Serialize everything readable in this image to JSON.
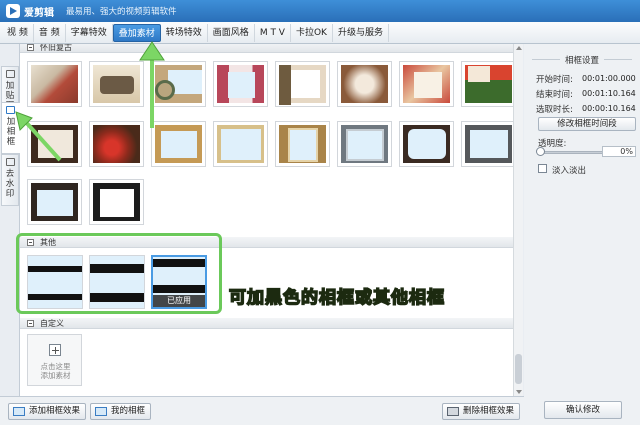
{
  "app": {
    "name": "爱剪辑",
    "slogan": "最易用、强大的视频剪辑软件"
  },
  "menu": {
    "items": [
      {
        "label": "视 频"
      },
      {
        "label": "音 频"
      },
      {
        "label": "字幕特效"
      },
      {
        "label": "叠加素材",
        "active": true
      },
      {
        "label": "转场特效"
      },
      {
        "label": "画面风格"
      },
      {
        "label": "M T V"
      },
      {
        "label": "卡拉OK"
      },
      {
        "label": "升级与服务"
      }
    ]
  },
  "sidetabs": [
    {
      "label": "加贴图"
    },
    {
      "label": "加相框",
      "active": true
    },
    {
      "label": "去水印"
    }
  ],
  "sections": {
    "retro": {
      "label": "怀旧复古"
    },
    "other": {
      "label": "其他"
    },
    "custom": {
      "label": "自定义"
    }
  },
  "applied_label": "已应用",
  "custom_add": {
    "line1": "点击这里",
    "line2": "添加素材"
  },
  "annotation": "可加黑色的相框或其他相框",
  "bottom": {
    "add_frame": "添加相框效果",
    "my_frames": "我的相框",
    "delete_frame": "删除相框效果"
  },
  "right_panel": {
    "title": "相框设置",
    "start_label": "开始时间:",
    "start_value": "00:01:00.000",
    "end_label": "结束时间:",
    "end_value": "00:01:10.164",
    "duration_label": "选取时长:",
    "duration_value": "00:00:10.164",
    "modify_button": "修改相框时间段",
    "opacity_label": "透明度:",
    "opacity_value": "0%",
    "fade_label": "淡入淡出",
    "confirm_button": "确认修改"
  },
  "colors": {
    "accent": "#2f79c6",
    "highlight_green": "#6bc95a",
    "annotation_yellow": "#f3d53a"
  }
}
